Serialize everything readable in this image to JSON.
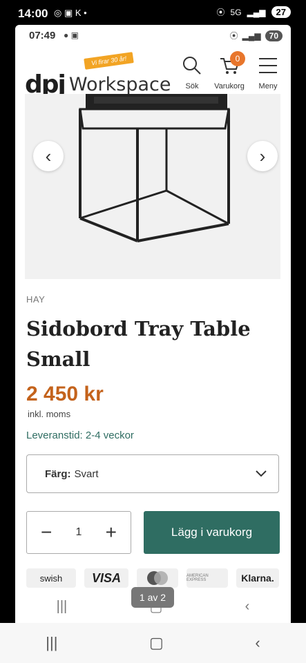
{
  "outer_status": {
    "time": "14:00",
    "left_icons": "◎ ▣ K •",
    "signal": "5G",
    "battery": "27"
  },
  "inner_status": {
    "time": "07:49",
    "left_icons": "● ▣",
    "battery": "70"
  },
  "header": {
    "logo_mark": "dpj",
    "logo_word": "Workspace",
    "ribbon": "Vi firar 30 år!",
    "search_label": "Sök",
    "cart_label": "Varukorg",
    "cart_count": "0",
    "menu_label": "Meny"
  },
  "gallery": {
    "prev": "‹",
    "next": "›"
  },
  "product": {
    "brand": "HAY",
    "title": "Sidobord Tray Table Small",
    "price": "2 450 kr",
    "vat_note": "inkl. moms",
    "delivery": "Leveranstid: 2-4 veckor",
    "color_label": "Färg:",
    "color_value": "Svart",
    "quantity": "1",
    "add_to_cart": "Lägg i varukorg"
  },
  "payments": [
    "swish",
    "VISA",
    "AMERICAN EXPRESS",
    "Klarna."
  ],
  "browser": {
    "page_indicator": "1 av 2"
  }
}
